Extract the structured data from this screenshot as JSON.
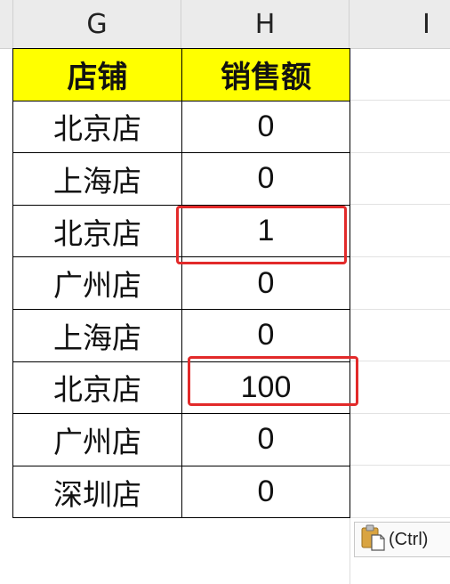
{
  "columns": {
    "g": "G",
    "h": "H",
    "i": "I"
  },
  "table": {
    "headers": [
      "店铺",
      "销售额"
    ],
    "rows": [
      [
        "北京店",
        "0"
      ],
      [
        "上海店",
        "0"
      ],
      [
        "北京店",
        "1"
      ],
      [
        "广州店",
        "0"
      ],
      [
        "上海店",
        "0"
      ],
      [
        "北京店",
        "100"
      ],
      [
        "广州店",
        "0"
      ],
      [
        "深圳店",
        "0"
      ]
    ]
  },
  "paste_options": {
    "label": "(Ctrl)",
    "icon": "clipboard-paste-icon"
  },
  "colors": {
    "header_fill": "#ffff00",
    "highlight": "#e22a2a"
  }
}
